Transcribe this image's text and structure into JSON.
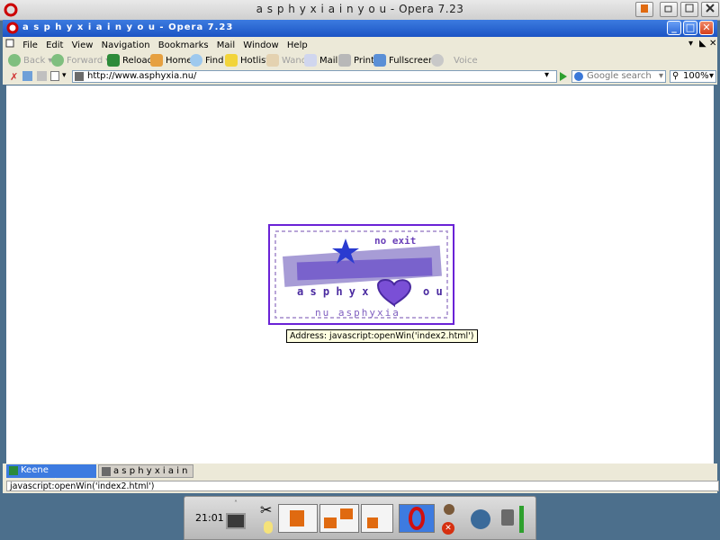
{
  "window": {
    "title": "a s p h y x i a i n y o u - Opera 7.23",
    "inner_title": "a s p h y x i a i n y o u - Opera 7.23"
  },
  "menu": {
    "items": [
      "File",
      "Edit",
      "View",
      "Navigation",
      "Bookmarks",
      "Mail",
      "Window",
      "Help"
    ]
  },
  "toolbar": {
    "back": "Back",
    "forward": "Forward",
    "reload": "Reload",
    "home": "Home",
    "find": "Find",
    "hotlist": "Hotlist",
    "wand": "Wand",
    "mail": "Mail",
    "print": "Print",
    "fullscreen": "Fullscreen",
    "voice": "Voice"
  },
  "address_bar": {
    "url": "http://www.asphyxia.nu/",
    "search_placeholder": "Google search",
    "zoom": "100%"
  },
  "content": {
    "logo_text_1": "no exit",
    "logo_text_2": "a s p h y x",
    "logo_text_3": "o u",
    "logo_text_4": "nu asphyxia",
    "tooltip": "Address: javascript:openWin('index2.html')"
  },
  "tabs": [
    {
      "label": "Keene Enterprises"
    },
    {
      "label": "a s p h y x i a i n y ..."
    }
  ],
  "status": {
    "text": "javascript:openWin('index2.html')"
  },
  "panel": {
    "clock": "21:01"
  },
  "colors": {
    "logo_border": "#6a22d6",
    "title_blue": "#1c54c4",
    "desktop": "#4c6f8c"
  }
}
